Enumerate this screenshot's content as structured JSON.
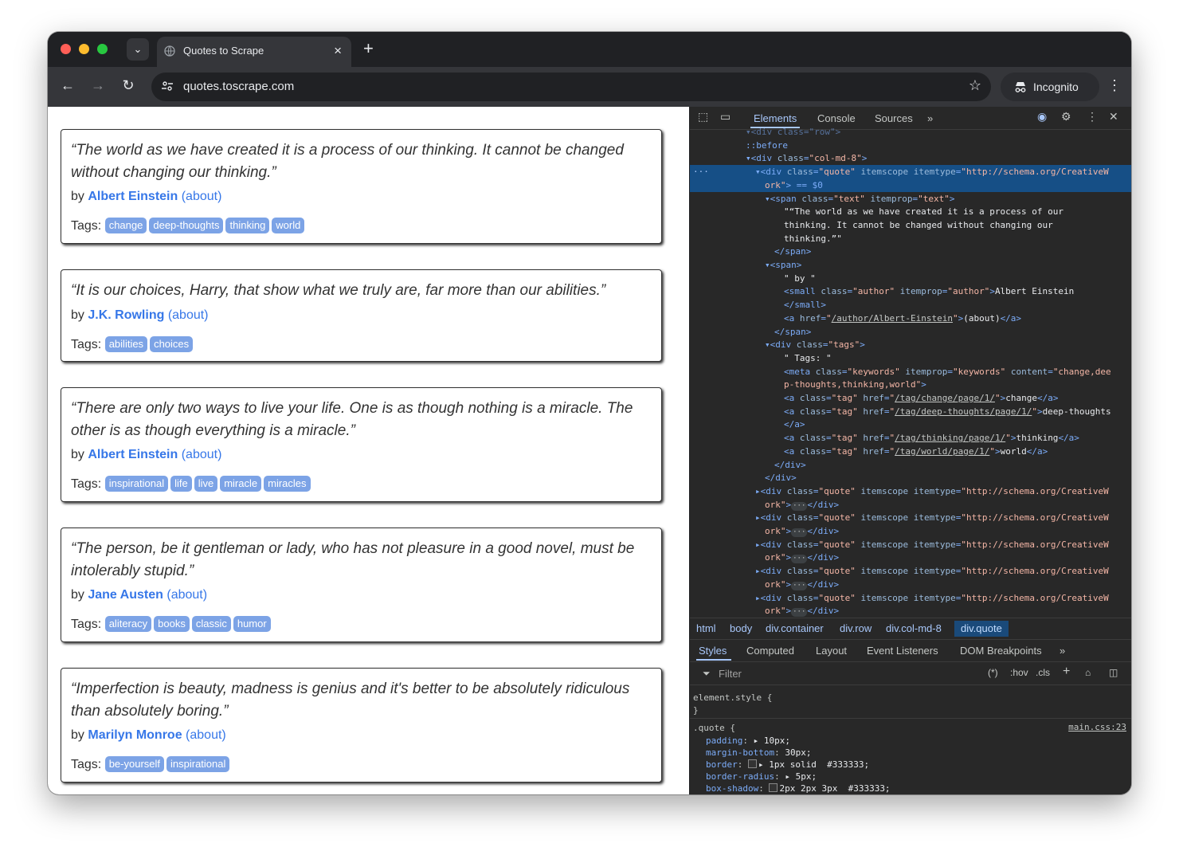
{
  "browser": {
    "tab_title": "Quotes to Scrape",
    "url": "quotes.toscrape.com",
    "profile_label": "Incognito"
  },
  "quotes": [
    {
      "text": "“The world as we have created it is a process of our thinking. It cannot be changed without changing our thinking.”",
      "by": "by",
      "author": "Albert Einstein",
      "about": "(about)",
      "tags_label": "Tags:",
      "tags": [
        "change",
        "deep-thoughts",
        "thinking",
        "world"
      ]
    },
    {
      "text": "“It is our choices, Harry, that show what we truly are, far more than our abilities.”",
      "by": "by",
      "author": "J.K. Rowling",
      "about": "(about)",
      "tags_label": "Tags:",
      "tags": [
        "abilities",
        "choices"
      ]
    },
    {
      "text": "“There are only two ways to live your life. One is as though nothing is a miracle. The other is as though everything is a miracle.”",
      "by": "by",
      "author": "Albert Einstein",
      "about": "(about)",
      "tags_label": "Tags:",
      "tags": [
        "inspirational",
        "life",
        "live",
        "miracle",
        "miracles"
      ]
    },
    {
      "text": "“The person, be it gentleman or lady, who has not pleasure in a good novel, must be intolerably stupid.”",
      "by": "by",
      "author": "Jane Austen",
      "about": "(about)",
      "tags_label": "Tags:",
      "tags": [
        "aliteracy",
        "books",
        "classic",
        "humor"
      ]
    },
    {
      "text": "“Imperfection is beauty, madness is genius and it's better to be absolutely ridiculous than absolutely boring.”",
      "by": "by",
      "author": "Marilyn Monroe",
      "about": "(about)",
      "tags_label": "Tags:",
      "tags": [
        "be-yourself",
        "inspirational"
      ]
    }
  ],
  "devtools": {
    "tabs": [
      "Elements",
      "Console",
      "Sources",
      "»"
    ],
    "dom_lines": [
      {
        "indent": 5,
        "parts": [
          [
            "t",
            "▾<div class=\"row\">"
          ]
        ],
        "sel": false,
        "clip": true
      },
      {
        "indent": 5,
        "parts": [
          [
            "t",
            "::before"
          ]
        ],
        "sel": false
      },
      {
        "indent": 5,
        "parts": [
          [
            "g",
            "▾<div "
          ],
          [
            "a",
            "class"
          ],
          [
            "g",
            "="
          ],
          [
            "v",
            "\"col-md-8\""
          ],
          [
            "g",
            ">"
          ]
        ],
        "sel": false
      },
      {
        "indent": 6,
        "parts": [
          [
            "g",
            "▾<div "
          ],
          [
            "a",
            "class"
          ],
          [
            "g",
            "="
          ],
          [
            "v",
            "\"quote\""
          ],
          [
            "a",
            " itemscope itemtype"
          ],
          [
            "g",
            "="
          ],
          [
            "v",
            "\"http://schema.org/CreativeW"
          ]
        ],
        "sel": true,
        "gutter": "···"
      },
      {
        "indent": 7,
        "parts": [
          [
            "v",
            "ork\""
          ],
          [
            "g",
            ">"
          ],
          [
            "t",
            " == $0"
          ]
        ],
        "sel": true
      },
      {
        "indent": 7,
        "parts": [
          [
            "g",
            "▾<span "
          ],
          [
            "a",
            "class"
          ],
          [
            "g",
            "="
          ],
          [
            "v",
            "\"text\""
          ],
          [
            "a",
            " itemprop"
          ],
          [
            "g",
            "="
          ],
          [
            "v",
            "\"text\""
          ],
          [
            "g",
            ">"
          ]
        ],
        "sel": false
      },
      {
        "indent": 9,
        "parts": [
          [
            "x",
            "\"“The world as we have created it is a process of our"
          ]
        ],
        "sel": false
      },
      {
        "indent": 9,
        "parts": [
          [
            "x",
            "thinking. It cannot be changed without changing our"
          ]
        ],
        "sel": false
      },
      {
        "indent": 9,
        "parts": [
          [
            "x",
            "thinking.”\""
          ]
        ],
        "sel": false
      },
      {
        "indent": 8,
        "parts": [
          [
            "g",
            "</span>"
          ]
        ],
        "sel": false
      },
      {
        "indent": 7,
        "parts": [
          [
            "g",
            "▾<span>"
          ]
        ],
        "sel": false
      },
      {
        "indent": 9,
        "parts": [
          [
            "x",
            "\" by \""
          ]
        ],
        "sel": false
      },
      {
        "indent": 9,
        "parts": [
          [
            "g",
            "<small "
          ],
          [
            "a",
            "class"
          ],
          [
            "g",
            "="
          ],
          [
            "v",
            "\"author\""
          ],
          [
            "a",
            " itemprop"
          ],
          [
            "g",
            "="
          ],
          [
            "v",
            "\"author\""
          ],
          [
            "g",
            ">"
          ],
          [
            "x",
            "Albert Einstein"
          ]
        ],
        "sel": false
      },
      {
        "indent": 9,
        "parts": [
          [
            "g",
            "</small>"
          ]
        ],
        "sel": false
      },
      {
        "indent": 9,
        "parts": [
          [
            "g",
            "<a "
          ],
          [
            "a",
            "href"
          ],
          [
            "g",
            "="
          ],
          [
            "v",
            "\""
          ],
          [
            "l",
            "/author/Albert-Einstein"
          ],
          [
            "v",
            "\""
          ],
          [
            "g",
            ">"
          ],
          [
            "x",
            "(about)"
          ],
          [
            "g",
            "</a>"
          ]
        ],
        "sel": false
      },
      {
        "indent": 8,
        "parts": [
          [
            "g",
            "</span>"
          ]
        ],
        "sel": false
      },
      {
        "indent": 7,
        "parts": [
          [
            "g",
            "▾<div "
          ],
          [
            "a",
            "class"
          ],
          [
            "g",
            "="
          ],
          [
            "v",
            "\"tags\""
          ],
          [
            "g",
            ">"
          ]
        ],
        "sel": false
      },
      {
        "indent": 9,
        "parts": [
          [
            "x",
            "\" Tags: \""
          ]
        ],
        "sel": false
      },
      {
        "indent": 9,
        "parts": [
          [
            "g",
            "<meta "
          ],
          [
            "a",
            "class"
          ],
          [
            "g",
            "="
          ],
          [
            "v",
            "\"keywords\""
          ],
          [
            "a",
            " itemprop"
          ],
          [
            "g",
            "="
          ],
          [
            "v",
            "\"keywords\""
          ],
          [
            "a",
            " content"
          ],
          [
            "g",
            "="
          ],
          [
            "v",
            "\"change,dee"
          ]
        ],
        "sel": false
      },
      {
        "indent": 9,
        "parts": [
          [
            "v",
            "p-thoughts,thinking,world\""
          ],
          [
            "g",
            ">"
          ]
        ],
        "sel": false
      },
      {
        "indent": 9,
        "parts": [
          [
            "g",
            "<a "
          ],
          [
            "a",
            "class"
          ],
          [
            "g",
            "="
          ],
          [
            "v",
            "\"tag\""
          ],
          [
            "a",
            " href"
          ],
          [
            "g",
            "="
          ],
          [
            "v",
            "\""
          ],
          [
            "l",
            "/tag/change/page/1/"
          ],
          [
            "v",
            "\""
          ],
          [
            "g",
            ">"
          ],
          [
            "x",
            "change"
          ],
          [
            "g",
            "</a>"
          ]
        ],
        "sel": false
      },
      {
        "indent": 9,
        "parts": [
          [
            "g",
            "<a "
          ],
          [
            "a",
            "class"
          ],
          [
            "g",
            "="
          ],
          [
            "v",
            "\"tag\""
          ],
          [
            "a",
            " href"
          ],
          [
            "g",
            "="
          ],
          [
            "v",
            "\""
          ],
          [
            "l",
            "/tag/deep-thoughts/page/1/"
          ],
          [
            "v",
            "\""
          ],
          [
            "g",
            ">"
          ],
          [
            "x",
            "deep-thoughts"
          ]
        ],
        "sel": false
      },
      {
        "indent": 9,
        "parts": [
          [
            "g",
            "</a>"
          ]
        ],
        "sel": false
      },
      {
        "indent": 9,
        "parts": [
          [
            "g",
            "<a "
          ],
          [
            "a",
            "class"
          ],
          [
            "g",
            "="
          ],
          [
            "v",
            "\"tag\""
          ],
          [
            "a",
            " href"
          ],
          [
            "g",
            "="
          ],
          [
            "v",
            "\""
          ],
          [
            "l",
            "/tag/thinking/page/1/"
          ],
          [
            "v",
            "\""
          ],
          [
            "g",
            ">"
          ],
          [
            "x",
            "thinking"
          ],
          [
            "g",
            "</a>"
          ]
        ],
        "sel": false
      },
      {
        "indent": 9,
        "parts": [
          [
            "g",
            "<a "
          ],
          [
            "a",
            "class"
          ],
          [
            "g",
            "="
          ],
          [
            "v",
            "\"tag\""
          ],
          [
            "a",
            " href"
          ],
          [
            "g",
            "="
          ],
          [
            "v",
            "\""
          ],
          [
            "l",
            "/tag/world/page/1/"
          ],
          [
            "v",
            "\""
          ],
          [
            "g",
            ">"
          ],
          [
            "x",
            "world"
          ],
          [
            "g",
            "</a>"
          ]
        ],
        "sel": false
      },
      {
        "indent": 8,
        "parts": [
          [
            "g",
            "</div>"
          ]
        ],
        "sel": false
      },
      {
        "indent": 7,
        "parts": [
          [
            "g",
            "</div>"
          ]
        ],
        "sel": false
      },
      {
        "indent": 6,
        "parts": [
          [
            "g",
            "▸<div "
          ],
          [
            "a",
            "class"
          ],
          [
            "g",
            "="
          ],
          [
            "v",
            "\"quote\""
          ],
          [
            "a",
            " itemscope itemtype"
          ],
          [
            "g",
            "="
          ],
          [
            "v",
            "\"http://schema.org/CreativeW"
          ]
        ],
        "sel": false
      },
      {
        "indent": 7,
        "parts": [
          [
            "v",
            "ork\""
          ],
          [
            "g",
            ">"
          ],
          [
            "d",
            "···"
          ],
          [
            "g",
            "</div>"
          ]
        ],
        "sel": false
      },
      {
        "indent": 6,
        "parts": [
          [
            "g",
            "▸<div "
          ],
          [
            "a",
            "class"
          ],
          [
            "g",
            "="
          ],
          [
            "v",
            "\"quote\""
          ],
          [
            "a",
            " itemscope itemtype"
          ],
          [
            "g",
            "="
          ],
          [
            "v",
            "\"http://schema.org/CreativeW"
          ]
        ],
        "sel": false
      },
      {
        "indent": 7,
        "parts": [
          [
            "v",
            "ork\""
          ],
          [
            "g",
            ">"
          ],
          [
            "d",
            "···"
          ],
          [
            "g",
            "</div>"
          ]
        ],
        "sel": false
      },
      {
        "indent": 6,
        "parts": [
          [
            "g",
            "▸<div "
          ],
          [
            "a",
            "class"
          ],
          [
            "g",
            "="
          ],
          [
            "v",
            "\"quote\""
          ],
          [
            "a",
            " itemscope itemtype"
          ],
          [
            "g",
            "="
          ],
          [
            "v",
            "\"http://schema.org/CreativeW"
          ]
        ],
        "sel": false
      },
      {
        "indent": 7,
        "parts": [
          [
            "v",
            "ork\""
          ],
          [
            "g",
            ">"
          ],
          [
            "d",
            "···"
          ],
          [
            "g",
            "</div>"
          ]
        ],
        "sel": false
      },
      {
        "indent": 6,
        "parts": [
          [
            "g",
            "▸<div "
          ],
          [
            "a",
            "class"
          ],
          [
            "g",
            "="
          ],
          [
            "v",
            "\"quote\""
          ],
          [
            "a",
            " itemscope itemtype"
          ],
          [
            "g",
            "="
          ],
          [
            "v",
            "\"http://schema.org/CreativeW"
          ]
        ],
        "sel": false
      },
      {
        "indent": 7,
        "parts": [
          [
            "v",
            "ork\""
          ],
          [
            "g",
            ">"
          ],
          [
            "d",
            "···"
          ],
          [
            "g",
            "</div>"
          ]
        ],
        "sel": false
      },
      {
        "indent": 6,
        "parts": [
          [
            "g",
            "▸<div "
          ],
          [
            "a",
            "class"
          ],
          [
            "g",
            "="
          ],
          [
            "v",
            "\"quote\""
          ],
          [
            "a",
            " itemscope itemtype"
          ],
          [
            "g",
            "="
          ],
          [
            "v",
            "\"http://schema.org/CreativeW"
          ]
        ],
        "sel": false
      },
      {
        "indent": 7,
        "parts": [
          [
            "v",
            "ork\""
          ],
          [
            "g",
            ">"
          ],
          [
            "d",
            "···"
          ],
          [
            "g",
            "</div>"
          ]
        ],
        "sel": false
      }
    ],
    "breadcrumbs": [
      "html",
      "body",
      "div.container",
      "div.row",
      "div.col-md-8",
      "div.quote"
    ],
    "subtabs": [
      "Styles",
      "Computed",
      "Layout",
      "Event Listeners",
      "DOM Breakpoints",
      "»"
    ],
    "filter_placeholder": "Filter",
    "filter_tools": [
      ":hov",
      ".cls"
    ],
    "element_style_open": "element.style {",
    "element_style_close": "}",
    "rule_selector": ".quote {",
    "rule_source": "main.css:23",
    "rule_props": [
      {
        "name": "padding",
        "value": "▸ 10px;"
      },
      {
        "name": "margin-bottom",
        "value": "30px;"
      },
      {
        "name": "border",
        "value": "▸ 1px solid  #333333;",
        "swatch": true
      },
      {
        "name": "border-radius",
        "value": "▸ 5px;"
      },
      {
        "name": "box-shadow",
        "value": "2px 2px 3px  #333333;",
        "swatch": true
      }
    ]
  },
  "colors": {
    "accent": "#3677e8",
    "tag_bg": "#7ca3e6",
    "devtools_bg": "#282828",
    "selected_row": "#164f86"
  }
}
